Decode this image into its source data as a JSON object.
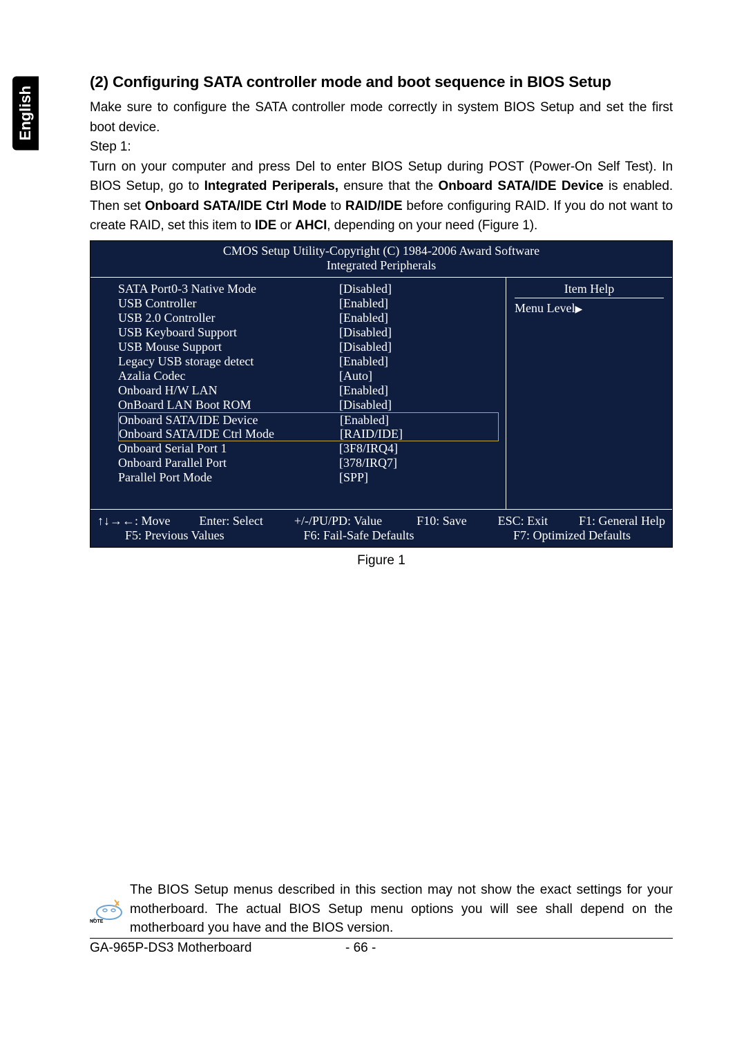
{
  "language_tab": "English",
  "heading": "(2)  Configuring SATA controller mode and boot sequence in BIOS Setup",
  "p1a": "Make sure to configure the SATA controller mode correctly in system BIOS Setup and set the first boot device.",
  "step1": "Step 1:",
  "p2a": "Turn on your computer and press Del to enter BIOS Setup during POST (Power-On Self Test). In BIOS Setup, go to ",
  "p2b": "Integrated Periperals,",
  "p2c": " ensure that the ",
  "p2d": "Onboard SATA/IDE Device",
  "p2e": " is enabled. Then set ",
  "p2f": "Onboard SATA/IDE Ctrl Mode",
  "p2g": " to ",
  "p2h": "RAID/IDE",
  "p2i": " before configuring RAID. If you do not want to create RAID, set this item to ",
  "p2j": "IDE",
  "p2k": " or ",
  "p2l": "AHCI",
  "p2m": ", depending on your need (Figure 1).",
  "bios": {
    "title1": "CMOS Setup Utility-Copyright (C) 1984-2006 Award Software",
    "title2": "Integrated Peripherals",
    "rows": [
      {
        "label": "SATA Port0-3 Native Mode",
        "value": "[Disabled]",
        "hl": 0
      },
      {
        "label": "USB Controller",
        "value": "[Enabled]",
        "hl": 0
      },
      {
        "label": "USB 2.0 Controller",
        "value": "[Enabled]",
        "hl": 0
      },
      {
        "label": "USB Keyboard Support",
        "value": "[Disabled]",
        "hl": 0
      },
      {
        "label": "USB Mouse Support",
        "value": "[Disabled]",
        "hl": 0
      },
      {
        "label": "Legacy USB storage detect",
        "value": "[Enabled]",
        "hl": 0
      },
      {
        "label": "Azalia Codec",
        "value": "[Auto]",
        "hl": 0
      },
      {
        "label": "Onboard H/W LAN",
        "value": "[Enabled]",
        "hl": 0
      },
      {
        "label": "OnBoard LAN Boot ROM",
        "value": "[Disabled]",
        "hl": 0
      },
      {
        "label": "Onboard SATA/IDE Device",
        "value": "[Enabled]",
        "hl": 1
      },
      {
        "label": "Onboard SATA/IDE Ctrl Mode",
        "value": "[RAID/IDE]",
        "hl": 2
      },
      {
        "label": "Onboard Serial Port 1",
        "value": "[3F8/IRQ4]",
        "hl": 0
      },
      {
        "label": "Onboard Parallel Port",
        "value": "[378/IRQ7]",
        "hl": 0
      },
      {
        "label": "Parallel Port Mode",
        "value": "[SPP]",
        "hl": 0
      }
    ],
    "item_help": "Item Help",
    "menu_level": "Menu Level",
    "footer": {
      "l1a": "↑↓→←: Move",
      "l1b": "Enter: Select",
      "l1c": "+/-/PU/PD: Value",
      "l1d": "F10: Save",
      "l1e": "ESC: Exit",
      "l1f": "F1: General Help",
      "l2a": "F5: Previous Values",
      "l2b": "F6: Fail-Safe Defaults",
      "l2c": "F7: Optimized Defaults"
    }
  },
  "figure_caption": "Figure 1",
  "note_text": "The BIOS Setup menus described in this section may not show the exact settings for your motherboard. The actual BIOS Setup menu options you will see shall depend on the motherboard you have and the BIOS version.",
  "note_label": "NOTE",
  "footer_model": "GA-965P-DS3 Motherboard",
  "footer_page": "- 66 -"
}
